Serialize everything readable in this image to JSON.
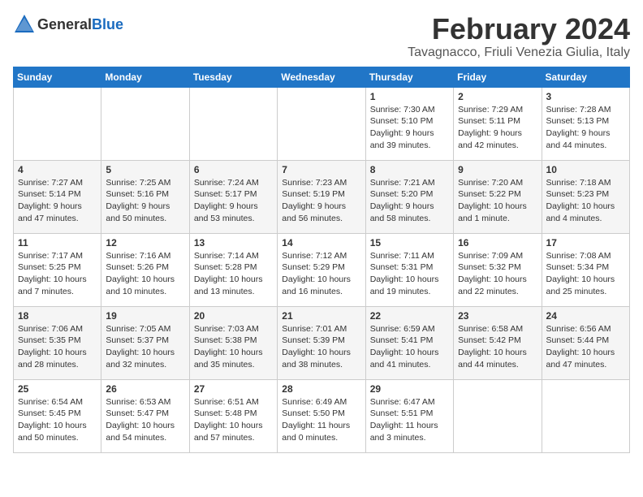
{
  "header": {
    "logo_general": "General",
    "logo_blue": "Blue",
    "month_title": "February 2024",
    "location": "Tavagnacco, Friuli Venezia Giulia, Italy"
  },
  "calendar": {
    "days_of_week": [
      "Sunday",
      "Monday",
      "Tuesday",
      "Wednesday",
      "Thursday",
      "Friday",
      "Saturday"
    ],
    "weeks": [
      [
        {
          "day": "",
          "info": ""
        },
        {
          "day": "",
          "info": ""
        },
        {
          "day": "",
          "info": ""
        },
        {
          "day": "",
          "info": ""
        },
        {
          "day": "1",
          "info": "Sunrise: 7:30 AM\nSunset: 5:10 PM\nDaylight: 9 hours\nand 39 minutes."
        },
        {
          "day": "2",
          "info": "Sunrise: 7:29 AM\nSunset: 5:11 PM\nDaylight: 9 hours\nand 42 minutes."
        },
        {
          "day": "3",
          "info": "Sunrise: 7:28 AM\nSunset: 5:13 PM\nDaylight: 9 hours\nand 44 minutes."
        }
      ],
      [
        {
          "day": "4",
          "info": "Sunrise: 7:27 AM\nSunset: 5:14 PM\nDaylight: 9 hours\nand 47 minutes."
        },
        {
          "day": "5",
          "info": "Sunrise: 7:25 AM\nSunset: 5:16 PM\nDaylight: 9 hours\nand 50 minutes."
        },
        {
          "day": "6",
          "info": "Sunrise: 7:24 AM\nSunset: 5:17 PM\nDaylight: 9 hours\nand 53 minutes."
        },
        {
          "day": "7",
          "info": "Sunrise: 7:23 AM\nSunset: 5:19 PM\nDaylight: 9 hours\nand 56 minutes."
        },
        {
          "day": "8",
          "info": "Sunrise: 7:21 AM\nSunset: 5:20 PM\nDaylight: 9 hours\nand 58 minutes."
        },
        {
          "day": "9",
          "info": "Sunrise: 7:20 AM\nSunset: 5:22 PM\nDaylight: 10 hours\nand 1 minute."
        },
        {
          "day": "10",
          "info": "Sunrise: 7:18 AM\nSunset: 5:23 PM\nDaylight: 10 hours\nand 4 minutes."
        }
      ],
      [
        {
          "day": "11",
          "info": "Sunrise: 7:17 AM\nSunset: 5:25 PM\nDaylight: 10 hours\nand 7 minutes."
        },
        {
          "day": "12",
          "info": "Sunrise: 7:16 AM\nSunset: 5:26 PM\nDaylight: 10 hours\nand 10 minutes."
        },
        {
          "day": "13",
          "info": "Sunrise: 7:14 AM\nSunset: 5:28 PM\nDaylight: 10 hours\nand 13 minutes."
        },
        {
          "day": "14",
          "info": "Sunrise: 7:12 AM\nSunset: 5:29 PM\nDaylight: 10 hours\nand 16 minutes."
        },
        {
          "day": "15",
          "info": "Sunrise: 7:11 AM\nSunset: 5:31 PM\nDaylight: 10 hours\nand 19 minutes."
        },
        {
          "day": "16",
          "info": "Sunrise: 7:09 AM\nSunset: 5:32 PM\nDaylight: 10 hours\nand 22 minutes."
        },
        {
          "day": "17",
          "info": "Sunrise: 7:08 AM\nSunset: 5:34 PM\nDaylight: 10 hours\nand 25 minutes."
        }
      ],
      [
        {
          "day": "18",
          "info": "Sunrise: 7:06 AM\nSunset: 5:35 PM\nDaylight: 10 hours\nand 28 minutes."
        },
        {
          "day": "19",
          "info": "Sunrise: 7:05 AM\nSunset: 5:37 PM\nDaylight: 10 hours\nand 32 minutes."
        },
        {
          "day": "20",
          "info": "Sunrise: 7:03 AM\nSunset: 5:38 PM\nDaylight: 10 hours\nand 35 minutes."
        },
        {
          "day": "21",
          "info": "Sunrise: 7:01 AM\nSunset: 5:39 PM\nDaylight: 10 hours\nand 38 minutes."
        },
        {
          "day": "22",
          "info": "Sunrise: 6:59 AM\nSunset: 5:41 PM\nDaylight: 10 hours\nand 41 minutes."
        },
        {
          "day": "23",
          "info": "Sunrise: 6:58 AM\nSunset: 5:42 PM\nDaylight: 10 hours\nand 44 minutes."
        },
        {
          "day": "24",
          "info": "Sunrise: 6:56 AM\nSunset: 5:44 PM\nDaylight: 10 hours\nand 47 minutes."
        }
      ],
      [
        {
          "day": "25",
          "info": "Sunrise: 6:54 AM\nSunset: 5:45 PM\nDaylight: 10 hours\nand 50 minutes."
        },
        {
          "day": "26",
          "info": "Sunrise: 6:53 AM\nSunset: 5:47 PM\nDaylight: 10 hours\nand 54 minutes."
        },
        {
          "day": "27",
          "info": "Sunrise: 6:51 AM\nSunset: 5:48 PM\nDaylight: 10 hours\nand 57 minutes."
        },
        {
          "day": "28",
          "info": "Sunrise: 6:49 AM\nSunset: 5:50 PM\nDaylight: 11 hours\nand 0 minutes."
        },
        {
          "day": "29",
          "info": "Sunrise: 6:47 AM\nSunset: 5:51 PM\nDaylight: 11 hours\nand 3 minutes."
        },
        {
          "day": "",
          "info": ""
        },
        {
          "day": "",
          "info": ""
        }
      ]
    ]
  }
}
